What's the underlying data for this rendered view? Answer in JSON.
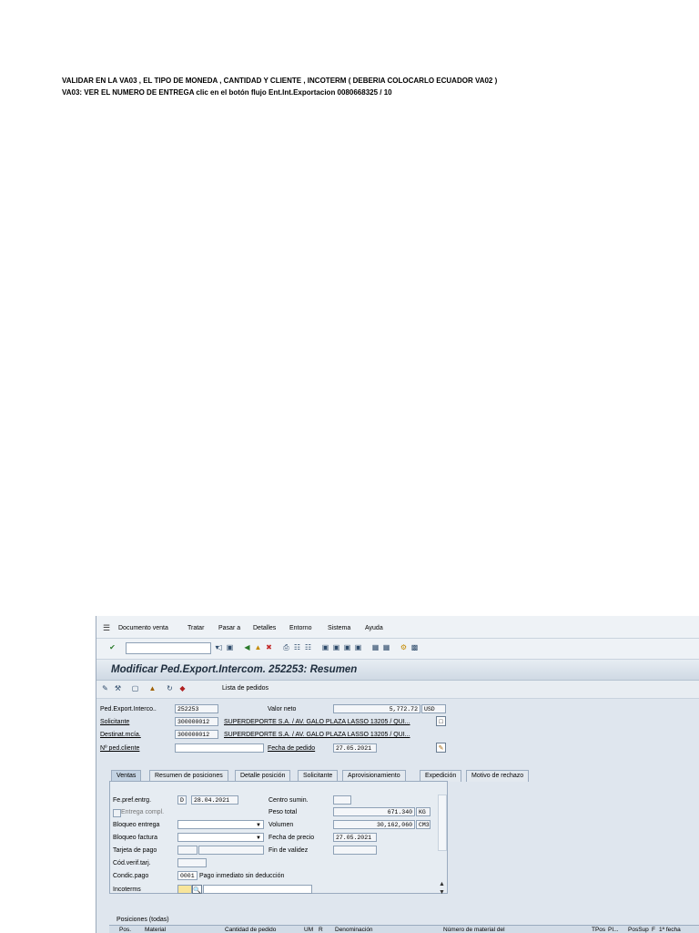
{
  "notes": {
    "line1": "VALIDAR EN LA VA03 , EL TIPO DE MONEDA , CANTIDAD Y CLIENTE , INCOTERM ( DEBERIA COLOCARLO ECUADOR VA02 )",
    "line2": "VA03: VER EL NUMERO DE ENTREGA clic en el botón flujo  Ent.Int.Exportacion 0080668325 / 10"
  },
  "menu": {
    "items": [
      "Documento venta",
      "Tratar",
      "Pasar a",
      "Detalles",
      "Entorno",
      "Sistema",
      "Ayuda"
    ]
  },
  "header": {
    "title": "Modificar Ped.Export.Intercom. 252253: Resumen",
    "lista_pedidos": "Lista de pedidos"
  },
  "order": {
    "doc_label": "Ped.Export.Interco..",
    "doc_value": "252253",
    "valor_neto_label": "Valor neto",
    "valor_neto": "5,772.72",
    "currency": "USD",
    "solicitante_label": "Solicitante",
    "solicitante_id": "300000012",
    "solicitante_name": "SUPERDEPORTE S.A. / AV. GALO PLAZA LASSO 13205 / QUI...",
    "destinat_label": "Destinat.mcía.",
    "destinat_id": "300000012",
    "destinat_name": "SUPERDEPORTE S.A. / AV. GALO PLAZA LASSO 13205 / QUI...",
    "ped_cliente_label": "Nº ped.cliente",
    "ped_cliente_value": "",
    "fecha_pedido_label": "Fecha de pedido",
    "fecha_pedido": "27.05.2021"
  },
  "tabs": [
    "Ventas",
    "Resumen de posiciones",
    "Detalle posición",
    "Solicitante",
    "Aprovisionamiento",
    "Expedición",
    "Motivo de rechazo"
  ],
  "ventas": {
    "fe_pref_label": "Fe.pref.entrg.",
    "fe_pref_unit": "D",
    "fe_pref_value": "28.04.2021",
    "entrega_compl_label": "Entrega compl.",
    "bloqueo_entrega_label": "Bloqueo entrega",
    "bloqueo_factura_label": "Bloqueo factura",
    "tarjeta_pago_label": "Tarjeta de pago",
    "cod_verif_label": "Cód.verif.tarj.",
    "condic_pago_label": "Condic.pago",
    "condic_pago_value": "0001",
    "condic_pago_text": "Pago inmediato sin deducción",
    "incoterms_label": "Incoterms",
    "centro_sumin_label": "Centro sumin.",
    "peso_total_label": "Peso total",
    "peso_total": "671.340",
    "peso_unit": "KG",
    "volumen_label": "Volumen",
    "volumen": "30,162,060",
    "volumen_unit": "CM3",
    "fecha_precio_label": "Fecha de precio",
    "fecha_precio": "27.05.2021",
    "fin_validez_label": "Fin de validez"
  },
  "positions": {
    "title": "Posiciones (todas)",
    "columns": [
      "Pos.",
      "Material",
      "Cantidad de pedido",
      "UM",
      "R",
      "Denominación",
      "Número de material del",
      "TPos",
      "PI...",
      "PosSup",
      "F",
      "1ª fecha"
    ]
  }
}
